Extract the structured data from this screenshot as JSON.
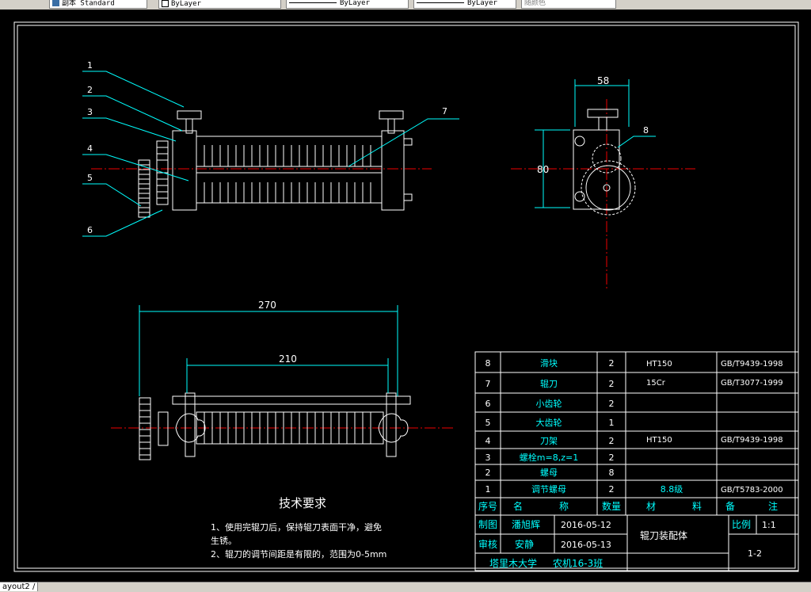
{
  "toolbar": {
    "text_style": "副本 Standard",
    "color": "ByLayer",
    "linetype": "ByLayer",
    "lineweight": "ByLayer",
    "plotstyle": "随颜色"
  },
  "drawing": {
    "parts": [
      "1",
      "2",
      "3",
      "4",
      "5",
      "6",
      "7",
      "8"
    ],
    "dims": {
      "d58": "58",
      "d80": "80",
      "d270": "270",
      "d210": "210"
    },
    "tech": {
      "title": "技术要求",
      "line1": "1、使用完辊刀后，保持辊刀表面干净，避免",
      "line2": "生锈。",
      "line3": "2、辊刀的调节间距是有限的，范围为0-5mm"
    }
  },
  "bom": {
    "rows": [
      {
        "no": "8",
        "name": "滑块",
        "qty": "2",
        "mat": "HT150",
        "std": "GB/T9439-1998"
      },
      {
        "no": "7",
        "name": "辊刀",
        "qty": "2",
        "mat": "15Cr",
        "std": "GB/T3077-1999"
      },
      {
        "no": "6",
        "name": "小齿轮",
        "qty": "2",
        "mat": "",
        "std": ""
      },
      {
        "no": "5",
        "name": "大齿轮",
        "qty": "1",
        "mat": "",
        "std": ""
      },
      {
        "no": "4",
        "name": "刀架",
        "qty": "2",
        "mat": "HT150",
        "std": "GB/T9439-1998"
      },
      {
        "no": "3",
        "name": "螺栓m=8,z=1",
        "qty": "2",
        "mat": "",
        "std": ""
      },
      {
        "no": "2",
        "name": "螺母",
        "qty": "8",
        "mat": "",
        "std": ""
      },
      {
        "no": "1",
        "name": "调节螺母",
        "qty": "2",
        "mat": "8.8级",
        "std": "GB/T5783-2000"
      }
    ],
    "header": {
      "no": "序号",
      "name1": "名",
      "name2": "称",
      "qty": "数量",
      "mat1": "材",
      "mat2": "料",
      "rem1": "备",
      "rem2": "注"
    }
  },
  "title_block": {
    "draw_label": "制图",
    "draw_name": "潘旭辉",
    "draw_date": "2016-05-12",
    "check_label": "审核",
    "check_name": "安静",
    "check_date": "2016-05-13",
    "title": "辊刀装配体",
    "scale_label": "比例",
    "scale": "1:1",
    "drawing_no": "1-2",
    "school": "塔里木大学",
    "class": "农机16-3班"
  },
  "status": {
    "layout_tab": "ayout2 /"
  }
}
